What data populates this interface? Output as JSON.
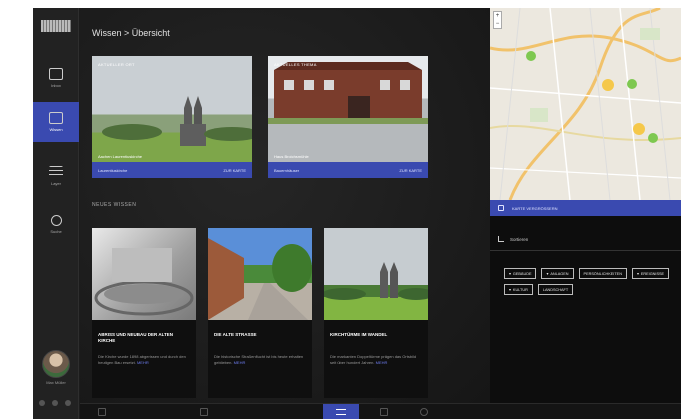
{
  "rail": {
    "items": [
      {
        "label": "Inbox",
        "icon": "inbox-icon"
      },
      {
        "label": "Wissen",
        "icon": "knowledge-icon",
        "active": true
      },
      {
        "label": "Layer",
        "icon": "layers-icon"
      },
      {
        "label": "Suche",
        "icon": "search-icon"
      }
    ],
    "user_name": "Max Müller"
  },
  "main": {
    "breadcrumb": "Wissen > Übersicht",
    "top_cards": [
      {
        "tag": "AKTUELLER ORT",
        "caption": "Aachen Laurentiuskirche",
        "link": "Laurentiuskirche",
        "action": "ZUR KARTE"
      },
      {
        "tag": "AKTUELLES THEMA",
        "caption": "Haus Broichsmühle",
        "link": "Bauernhäuser",
        "action": "ZUR KARTE"
      }
    ],
    "section_title": "NEUES WISSEN",
    "news": [
      {
        "title": "ABRISS UND NEUBAU DER ALTEN KIRCHE",
        "text": "Die Kirche wurde 1898 abgerissen und durch den heutigen Bau ersetzt.",
        "more": "MEHR"
      },
      {
        "title": "DIE ALTE STRASSE",
        "text": "Die historische Straßenflucht ist bis heute erhalten geblieben.",
        "more": "MEHR"
      },
      {
        "title": "KIRCHTÜRME IM WANDEL",
        "text": "Die markanten Doppeltürme prägen das Ortsbild seit über hundert Jahren.",
        "more": "MEHR"
      }
    ]
  },
  "map": {
    "zoom_in": "+",
    "zoom_out": "−",
    "bar_label": "KARTE VERGRÖSSERN"
  },
  "side": {
    "sort_label": "Sortieren",
    "filters": [
      {
        "label": "GEBÄUDE",
        "arrow": true
      },
      {
        "label": "ANLAGEN",
        "arrow": true
      },
      {
        "label": "PERSÖNLICHKEITEN",
        "arrow": false
      },
      {
        "label": "EREIGNISSE",
        "arrow": true
      },
      {
        "label": "KULTUR",
        "arrow": true
      },
      {
        "label": "LANDSCHAFT",
        "arrow": false
      }
    ]
  },
  "colors": {
    "accent": "#3a4ab0",
    "background": "#1c1c1c",
    "map_marker_green": "#7ec850",
    "map_marker_yellow": "#f5c84a"
  }
}
